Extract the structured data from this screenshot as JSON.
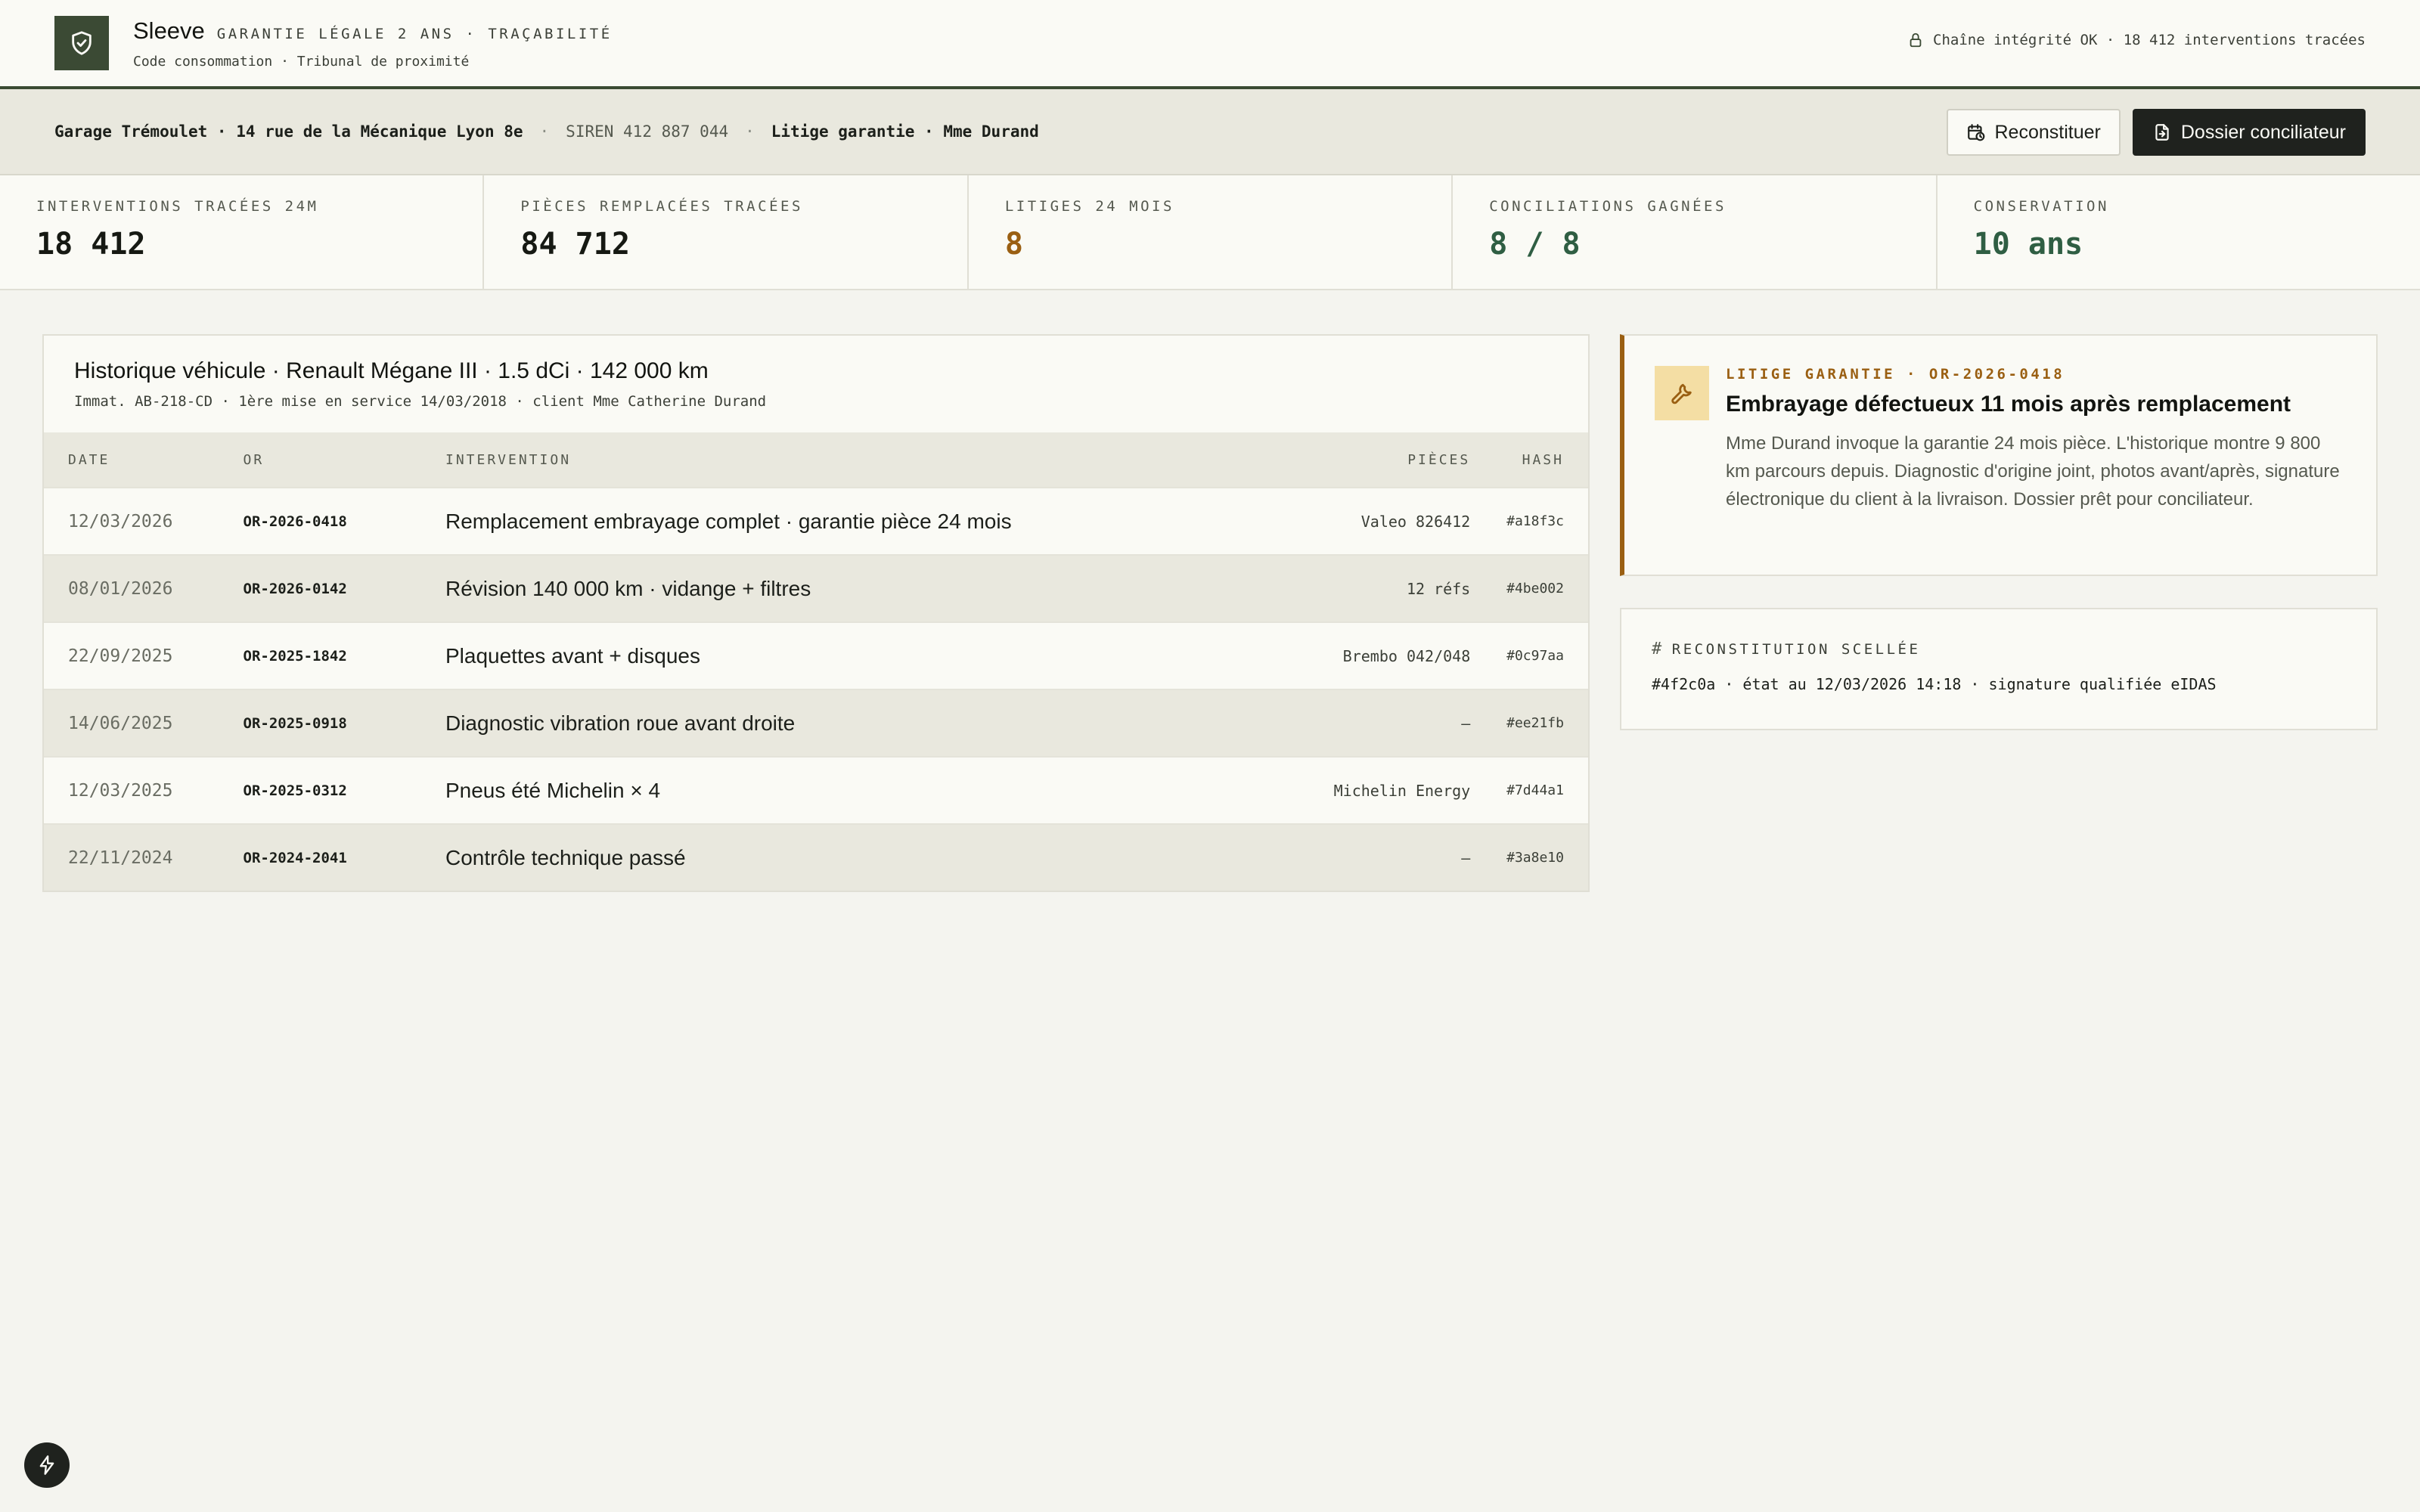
{
  "header": {
    "brand": "Sleeve",
    "tagline": "GARANTIE LÉGALE 2 ANS · TRAÇABILITÉ",
    "subtitle": "Code consommation · Tribunal de proximité",
    "integrity": "Chaîne intégrité OK · 18 412 interventions tracées"
  },
  "context": {
    "garage": "Garage Trémoulet · 14 rue de la Mécanique Lyon 8e",
    "siren": "SIREN 412 887 044",
    "case": "Litige garantie · Mme Durand",
    "sep": "·",
    "btn_reconstruct": "Reconstituer",
    "btn_dossier": "Dossier conciliateur"
  },
  "stats": [
    {
      "label": "INTERVENTIONS TRACÉES 24M",
      "value": "18 412"
    },
    {
      "label": "PIÈCES REMPLACÉES TRACÉES",
      "value": "84 712"
    },
    {
      "label": "LITIGES 24 MOIS",
      "value": "8"
    },
    {
      "label": "CONCILIATIONS GAGNÉES",
      "value": "8 / 8"
    },
    {
      "label": "CONSERVATION",
      "value": "10 ans"
    }
  ],
  "history": {
    "title": "Historique véhicule · Renault Mégane III · 1.5 dCi · 142 000 km",
    "subtitle": "Immat. AB-218-CD · 1ère mise en service 14/03/2018 · client Mme Catherine Durand",
    "columns": {
      "date": "DATE",
      "or": "OR",
      "intervention": "INTERVENTION",
      "parts": "PIÈCES",
      "hash": "HASH"
    },
    "rows": [
      {
        "date": "12/03/2026",
        "or": "OR-2026-0418",
        "intervention": "Remplacement embrayage complet · garantie pièce 24 mois",
        "parts": "Valeo 826412",
        "hash": "#a18f3c"
      },
      {
        "date": "08/01/2026",
        "or": "OR-2026-0142",
        "intervention": "Révision 140 000 km · vidange + filtres",
        "parts": "12 réfs",
        "hash": "#4be002"
      },
      {
        "date": "22/09/2025",
        "or": "OR-2025-1842",
        "intervention": "Plaquettes avant + disques",
        "parts": "Brembo 042/048",
        "hash": "#0c97aa"
      },
      {
        "date": "14/06/2025",
        "or": "OR-2025-0918",
        "intervention": "Diagnostic vibration roue avant droite",
        "parts": "—",
        "hash": "#ee21fb"
      },
      {
        "date": "12/03/2025",
        "or": "OR-2025-0312",
        "intervention": "Pneus été Michelin × 4",
        "parts": "Michelin Energy",
        "hash": "#7d44a1"
      },
      {
        "date": "22/11/2024",
        "or": "OR-2024-2041",
        "intervention": "Contrôle technique passé",
        "parts": "—",
        "hash": "#3a8e10"
      }
    ]
  },
  "dispute": {
    "tag": "LITIGE GARANTIE · OR-2026-0418",
    "title": "Embrayage défectueux 11 mois après remplacement",
    "text": "Mme Durand invoque la garantie 24 mois pièce. L'historique montre 9 800 km parcours depuis. Diagnostic d'origine joint, photos avant/après, signature électronique du client à la livraison. Dossier prêt pour conciliateur."
  },
  "sealed": {
    "label": "RECONSTITUTION SCELLÉE",
    "text": "#4f2c0a · état au 12/03/2026 14:18 · signature qualifiée eIDAS"
  },
  "colors": {
    "accent_green": "#3b4a34",
    "amber": "#9a5f12",
    "success": "#2f5e43"
  }
}
